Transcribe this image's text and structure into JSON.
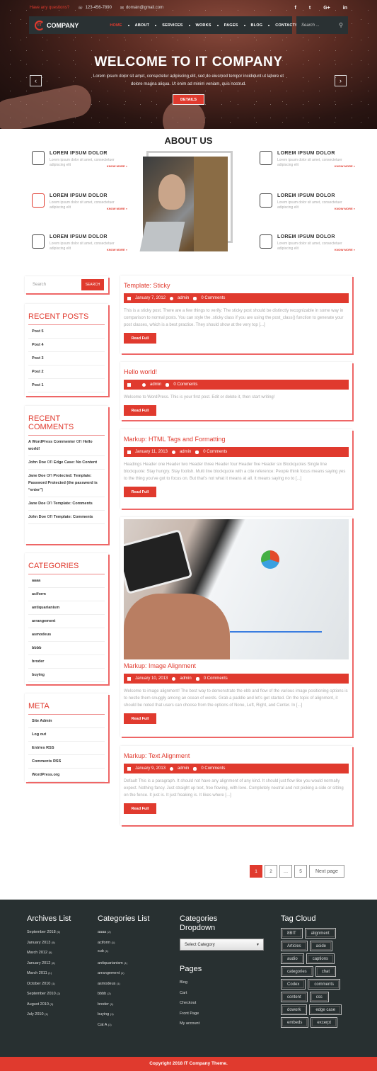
{
  "topbar": {
    "question": "Have any questions?",
    "phone": "123-456-7890",
    "email": "domain@gmail.com",
    "social": [
      "f",
      "t",
      "G+",
      "in"
    ]
  },
  "brand": {
    "logo_mark": "IT",
    "name": "COMPANY"
  },
  "nav": {
    "items": [
      "HOME",
      "ABOUT",
      "SERVICES",
      "WORKS",
      "PAGES",
      "BLOG",
      "CONTACTS"
    ],
    "search_placeholder": "Search ..."
  },
  "hero": {
    "title": "WELCOME TO IT COMPANY",
    "text": "Lorem ipsum dolor sit amet, consectetur adipiscing elit, sed do eiusmod tempor incididunt ut labore et dolore magna aliqua. Ut enim ad minim veniam, quis nostrud.",
    "button": "DETAILS",
    "prev": "‹",
    "next": "›"
  },
  "about": {
    "title": "ABOUT US",
    "features": [
      {
        "icon": "finance-icon",
        "title": "LOREM IPSUM DOLOR",
        "desc": "Lorem ipsum dolor sit amet, consectetuer adipiscing elit",
        "link": "KNOW MORE »"
      },
      {
        "icon": "developer-icon",
        "title": "LOREM IPSUM DOLOR",
        "desc": "Lorem ipsum dolor sit amet, consectetuer adipiscing elit",
        "link": "KNOW MORE »"
      },
      {
        "icon": "qr-code-icon",
        "title": "LOREM IPSUM DOLOR",
        "desc": "Lorem ipsum dolor sit amet, consectetuer adipiscing elit",
        "link": "KNOW MORE »"
      },
      {
        "icon": "support-agent-icon",
        "title": "LOREM IPSUM DOLOR",
        "desc": "Lorem ipsum dolor sit amet, consectetuer adipiscing elit",
        "link": "KNOW MORE »"
      },
      {
        "icon": "idea-icon",
        "title": "LOREM IPSUM DOLOR",
        "desc": "Lorem ipsum dolor sit amet, consectetuer adipiscing elit",
        "link": "KNOW MORE »"
      },
      {
        "icon": "hand-gear-icon",
        "title": "LOREM IPSUM DOLOR",
        "desc": "Lorem ipsum dolor sit amet, consectetuer adipiscing elit",
        "link": "KNOW MORE »"
      }
    ]
  },
  "sidebar": {
    "search": {
      "placeholder": "Search",
      "button": "SEARCH"
    },
    "recent_posts": {
      "title": "RECENT POSTS",
      "items": [
        "Post 5",
        "Post 4",
        "Post 3",
        "Post 2",
        "Post 1"
      ]
    },
    "recent_comments": {
      "title": "RECENT COMMENTS",
      "on": "on",
      "items": [
        {
          "author": "A WordPress Commenter",
          "post": "Hello world!"
        },
        {
          "author": "John Doe",
          "post": "Edge Case: No Content"
        },
        {
          "author": "Jane Doe",
          "post": "Protected: Template: Password Protected (the password is “enter”)"
        },
        {
          "author": "Jane Doe",
          "post": "Template: Comments"
        },
        {
          "author": "John Doe",
          "post": "Template: Comments"
        }
      ]
    },
    "categories": {
      "title": "CATEGORIES",
      "items": [
        "aaaa",
        "aciform",
        "antiquarianism",
        "arrangement",
        "asmodeus",
        "bbbb",
        "broder",
        "buying"
      ]
    },
    "meta": {
      "title": "META",
      "items": [
        "Site Admin",
        "Log out",
        "Entries RSS",
        "Comments RSS",
        "WordPress.org"
      ]
    }
  },
  "posts": [
    {
      "title": "Template: Sticky",
      "date": "January 7, 2012",
      "author": "admin",
      "comments": "0 Comments",
      "excerpt": "This is a sticky post. There are a few things to verify: The sticky post should be distinctly recognizable in some way in comparison to normal posts. You can style the .sticky class if you are using the post_class() function to generate your post classes, which is a best practice. They should show at the very top [...]",
      "button": "Read Full"
    },
    {
      "title": "Hello world!",
      "date": "",
      "author": "admin",
      "comments": "0 Comments",
      "excerpt": "Welcome to WordPress. This is your first post. Edit or delete it, then start writing!",
      "button": "Read Full"
    },
    {
      "title": "Markup: HTML Tags and Formatting",
      "date": "January 11, 2013",
      "author": "admin",
      "comments": "0 Comments",
      "excerpt": "Headings Header one Header two Header three Header four Header five Header six Blockquotes Single line blockquote: Stay hungry. Stay foolish. Multi line blockquote with a cite reference: People think focus means saying yes to the thing you’ve got to focus on. But that’s not what it means at all. It means saying no to [...]",
      "button": "Read Full"
    },
    {
      "title": "Markup: Image Alignment",
      "date": "January 10, 2013",
      "author": "admin",
      "comments": "0 Comments",
      "excerpt": "Welcome to image alignment! The best way to demonstrate the ebb and flow of the various image positioning options is to nestle them snuggly among an ocean of words. Grab a paddle and let’s get started. On the topic of alignment, it should be noted that users can choose from the options of None, Left, Right, and Center. In [...]",
      "button": "Read Full"
    },
    {
      "title": "Markup: Text Alignment",
      "date": "January 9, 2013",
      "author": "admin",
      "comments": "0 Comments",
      "excerpt": "Default This is a paragraph. It should not have any alignment of any kind. It should just flow like you would normally expect. Nothing fancy. Just straight up text, free flowing, with love. Completely neutral and not picking a side or sitting on the fence. It just is. It just freaking is. It likes where [...]",
      "button": "Read Full"
    }
  ],
  "pagination": {
    "pages": [
      "1",
      "2",
      "…",
      "5"
    ],
    "current": "1",
    "next": "Next page"
  },
  "footer": {
    "archives": {
      "title": "Archives List",
      "items": [
        [
          "September 2018",
          "(6)"
        ],
        [
          "January 2013",
          "(5)"
        ],
        [
          "March 2012",
          "(5)"
        ],
        [
          "January 2012",
          "(6)"
        ],
        [
          "March 2011",
          "(1)"
        ],
        [
          "October 2010",
          "(1)"
        ],
        [
          "September 2010",
          "(2)"
        ],
        [
          "August 2010",
          "(3)"
        ],
        [
          "July 2010",
          "(1)"
        ]
      ]
    },
    "categories": {
      "title": "Categories List",
      "items": [
        [
          "aaaa",
          "(2)"
        ],
        [
          "aciform",
          "(1)"
        ],
        [
          "sub",
          "(1)"
        ],
        [
          "antiquarianism",
          "(1)"
        ],
        [
          "arrangement",
          "(1)"
        ],
        [
          "asmodeus",
          "(1)"
        ],
        [
          "bbbb",
          "(2)"
        ],
        [
          "broder",
          "(1)"
        ],
        [
          "buying",
          "(1)"
        ],
        [
          "Cat A",
          "(1)"
        ]
      ]
    },
    "dropdown": {
      "title": "Categories Dropdown",
      "selected": "Select Category"
    },
    "pages": {
      "title": "Pages",
      "items": [
        "Blog",
        "Cart",
        "Checkout",
        "Front Page",
        "My account"
      ]
    },
    "tags": {
      "title": "Tag Cloud",
      "items": [
        "8BIT",
        "alignment",
        "Articles",
        "aside",
        "audio",
        "captions",
        "categories",
        "chat",
        "Codex",
        "comments",
        "content",
        "css",
        "dowork",
        "edge case",
        "embeds",
        "excerpt"
      ]
    },
    "copyright": "Copyright 2018 IT Company Theme."
  },
  "colors": {
    "accent": "#e03a2e",
    "dark": "#283031"
  }
}
